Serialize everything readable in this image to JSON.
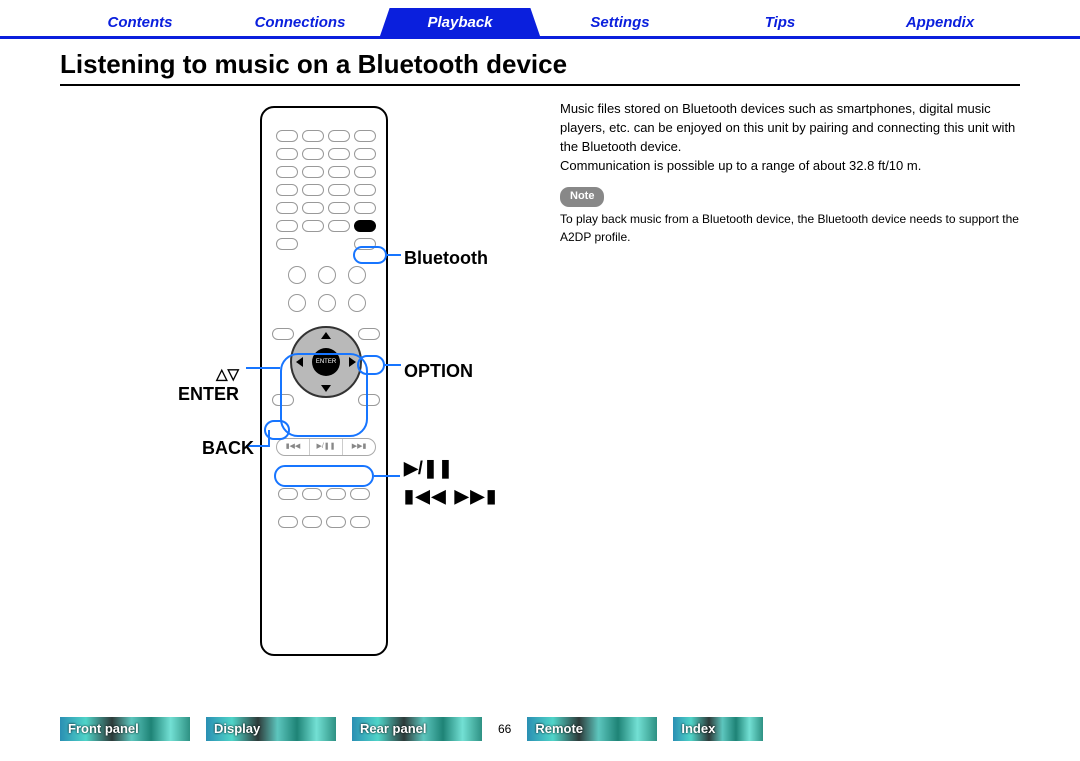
{
  "top_tabs": {
    "contents": "Contents",
    "connections": "Connections",
    "playback": "Playback",
    "settings": "Settings",
    "tips": "Tips",
    "appendix": "Appendix"
  },
  "title": "Listening to music on a Bluetooth device",
  "intro_p1": "Music files stored on Bluetooth devices such as smartphones, digital music players, etc. can be enjoyed on this unit by pairing and connecting this unit with the Bluetooth device.",
  "intro_p2": "Communication is possible up to a range of about 32.8 ft/10 m.",
  "note_label": "Note",
  "note_text": "To play back music from a Bluetooth device, the Bluetooth device needs to support the A2DP profile.",
  "callouts": {
    "bluetooth": "Bluetooth",
    "enter_arrows": "△▽",
    "enter": "ENTER",
    "back": "BACK",
    "option": "OPTION",
    "play_pause": "▶/❚❚",
    "skip": "▮◀◀ ▶▶▮"
  },
  "remote_label_enter": "ENTER",
  "page_number": "66",
  "footer": {
    "front": "Front panel",
    "display": "Display",
    "rear": "Rear panel",
    "remote": "Remote",
    "index": "Index"
  }
}
